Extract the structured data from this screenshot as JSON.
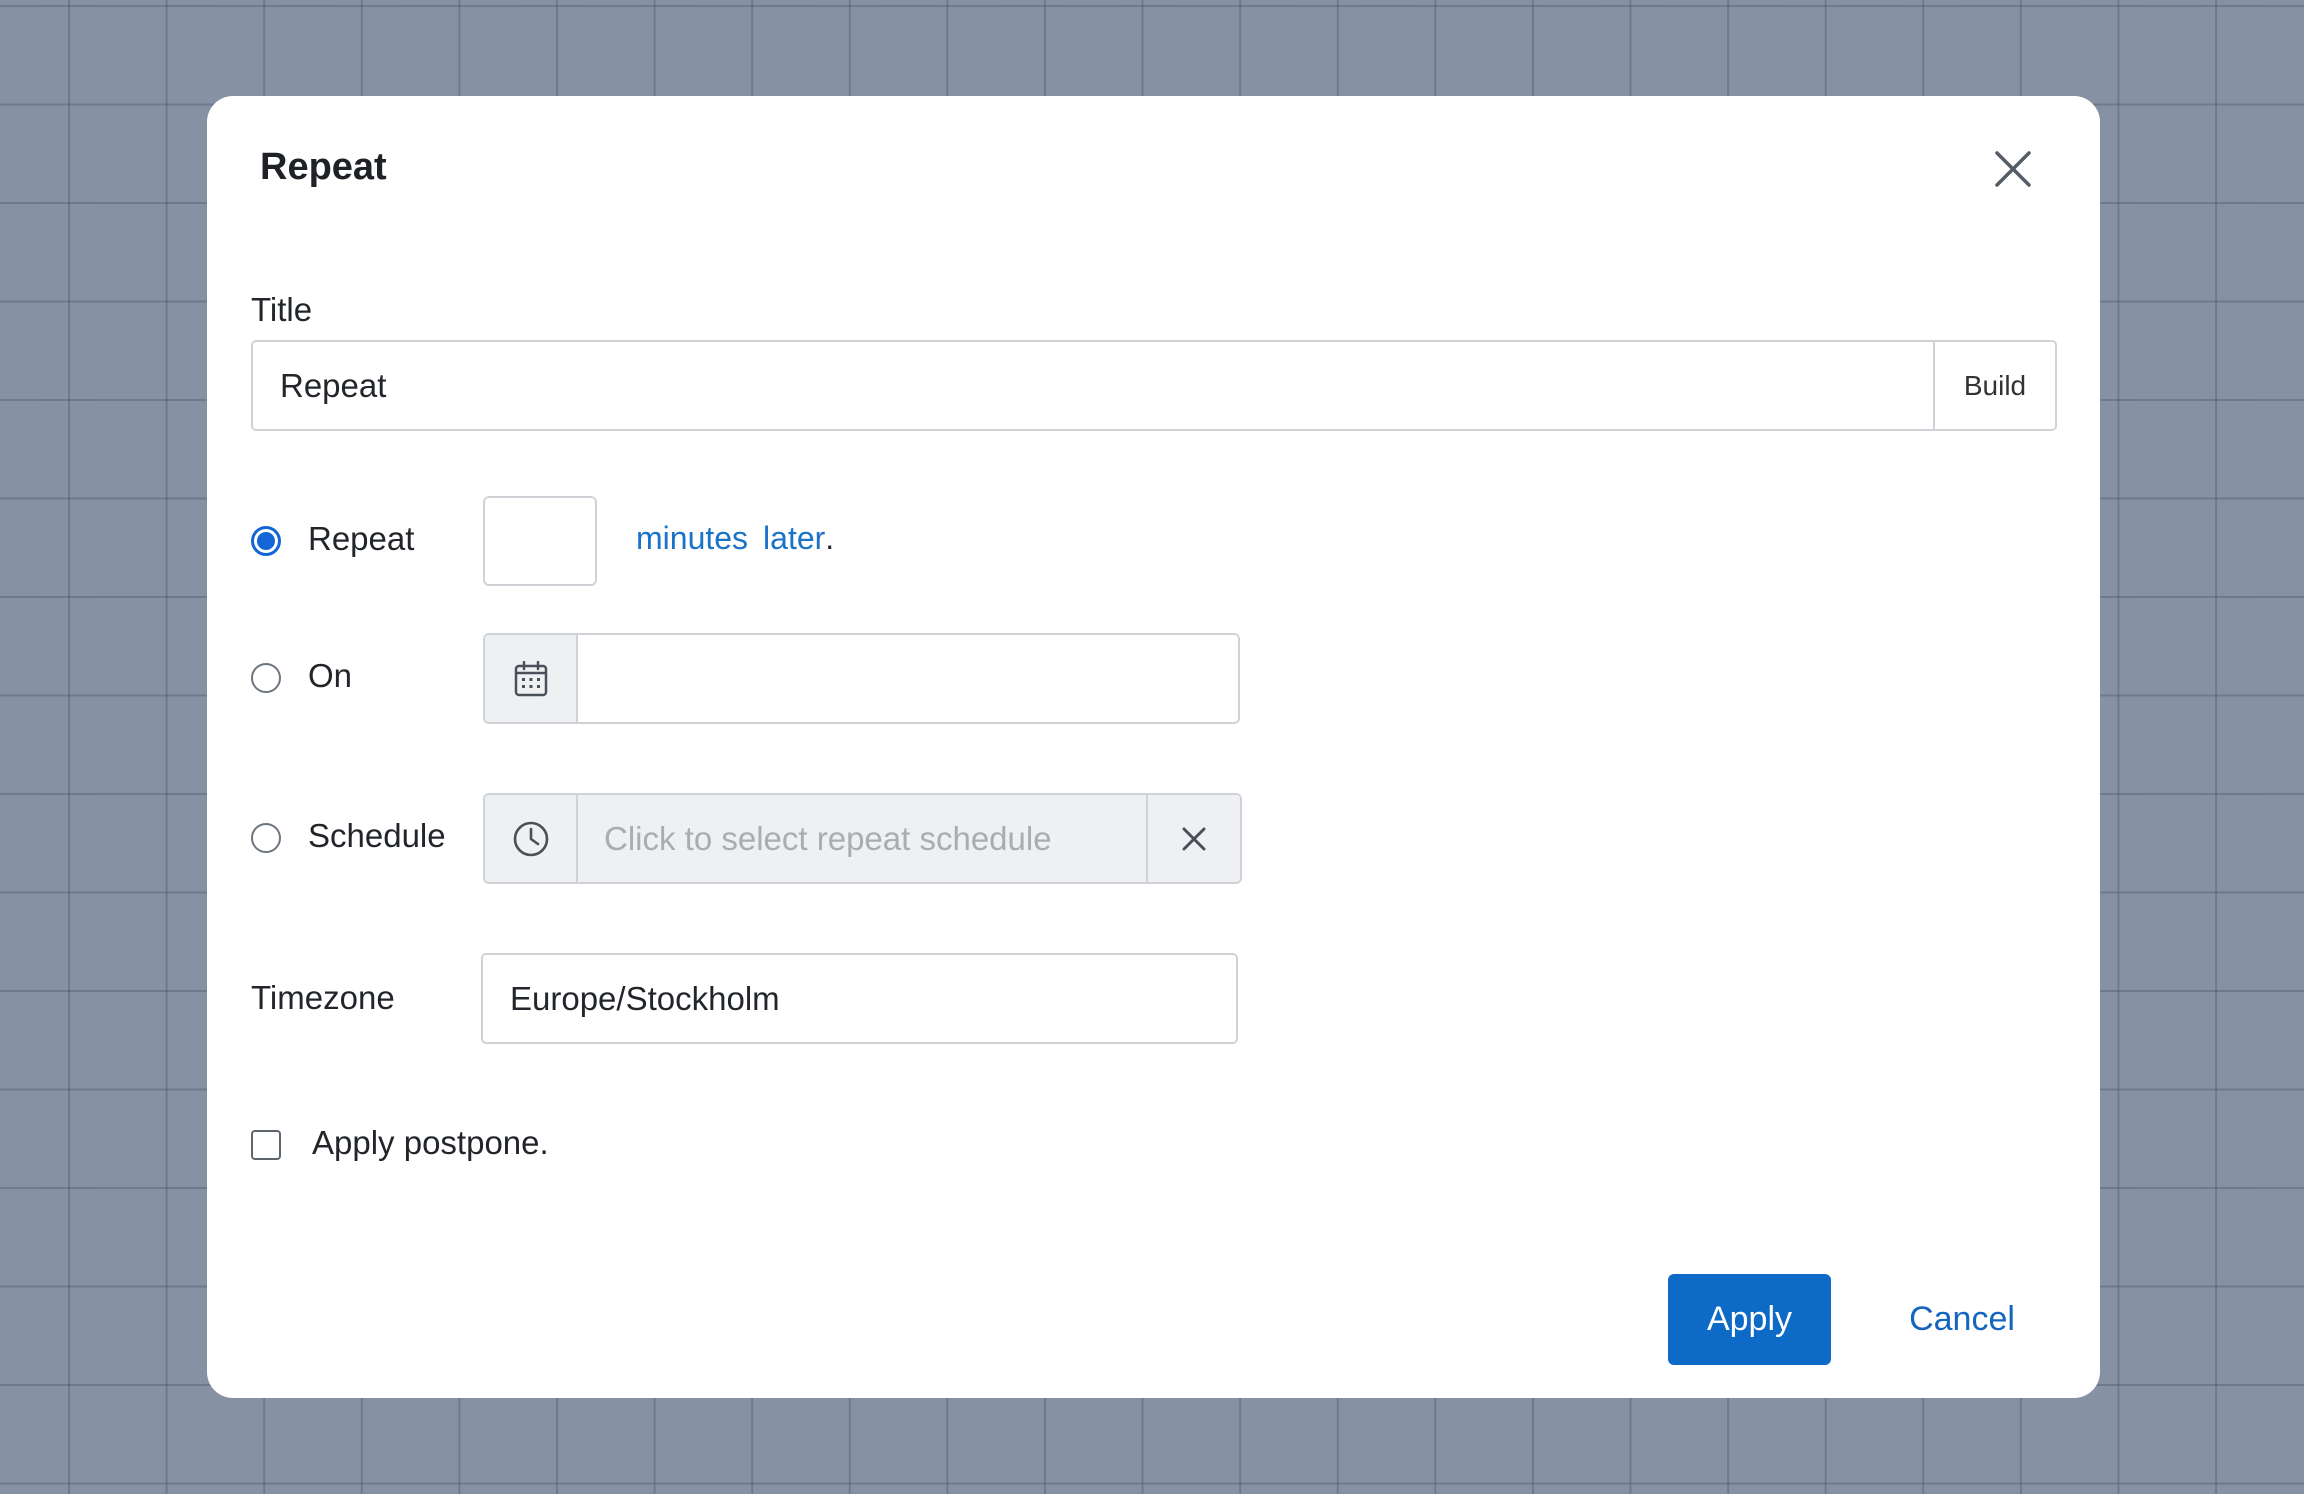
{
  "dialog": {
    "title": "Repeat",
    "close_icon": "close-icon"
  },
  "title_field": {
    "label": "Title",
    "value": "Repeat",
    "build_label": "Build"
  },
  "repeat_option": {
    "label": "Repeat",
    "checked": true,
    "minutes_value": "",
    "unit_link": "minutes",
    "later_link": "later",
    "suffix": "."
  },
  "on_option": {
    "label": "On",
    "checked": false,
    "icon": "calendar-icon",
    "value": ""
  },
  "schedule_option": {
    "label": "Schedule",
    "checked": false,
    "icon": "clock-icon",
    "placeholder": "Click to select repeat schedule",
    "clear_icon": "clear-icon"
  },
  "timezone": {
    "label": "Timezone",
    "value": "Europe/Stockholm"
  },
  "postpone": {
    "label": "Apply postpone.",
    "checked": false
  },
  "footer": {
    "apply_label": "Apply",
    "cancel_label": "Cancel"
  },
  "colors": {
    "primary": "#0e6ac7",
    "link": "#1a73c7",
    "backdrop": "#8692a4"
  }
}
